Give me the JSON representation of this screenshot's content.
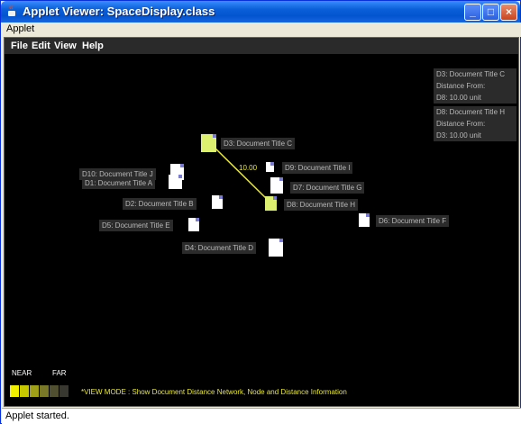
{
  "window": {
    "title": "Applet Viewer: SpaceDisplay.class"
  },
  "outer_menu": {
    "applet": "Applet"
  },
  "menu": {
    "file": "File",
    "edit": "Edit",
    "view": "View",
    "help": "Help"
  },
  "documents": {
    "d3": "D3: Document Title C",
    "d9": "D9: Document Title I",
    "d10": "D10: Document Title J",
    "d1": "D1: Document Title A",
    "d7": "D7: Document Title G",
    "d2": "D2: Document Title B",
    "d8": "D8: Document Title H",
    "d5": "D5: Document Title E",
    "d6": "D6: Document Title F",
    "d4": "D4: Document Title D"
  },
  "edge": {
    "distance": "10.00"
  },
  "info_panel": {
    "block1": {
      "title": "D3: Document Title C",
      "label": "Distance From:",
      "value": "D8: 10.00 unit"
    },
    "block2": {
      "title": "D8: Document Title H",
      "label": "Distance From:",
      "value": "D3: 10.00 unit"
    }
  },
  "legend": {
    "near": "NEAR",
    "far": "FAR",
    "colors": [
      "#f0f000",
      "#c8c800",
      "#a0a018",
      "#787828",
      "#505030",
      "#383830"
    ]
  },
  "mode_text": "*VIEW MODE : Show Document Distance Network, Node and Distance Information",
  "status": "Applet started."
}
